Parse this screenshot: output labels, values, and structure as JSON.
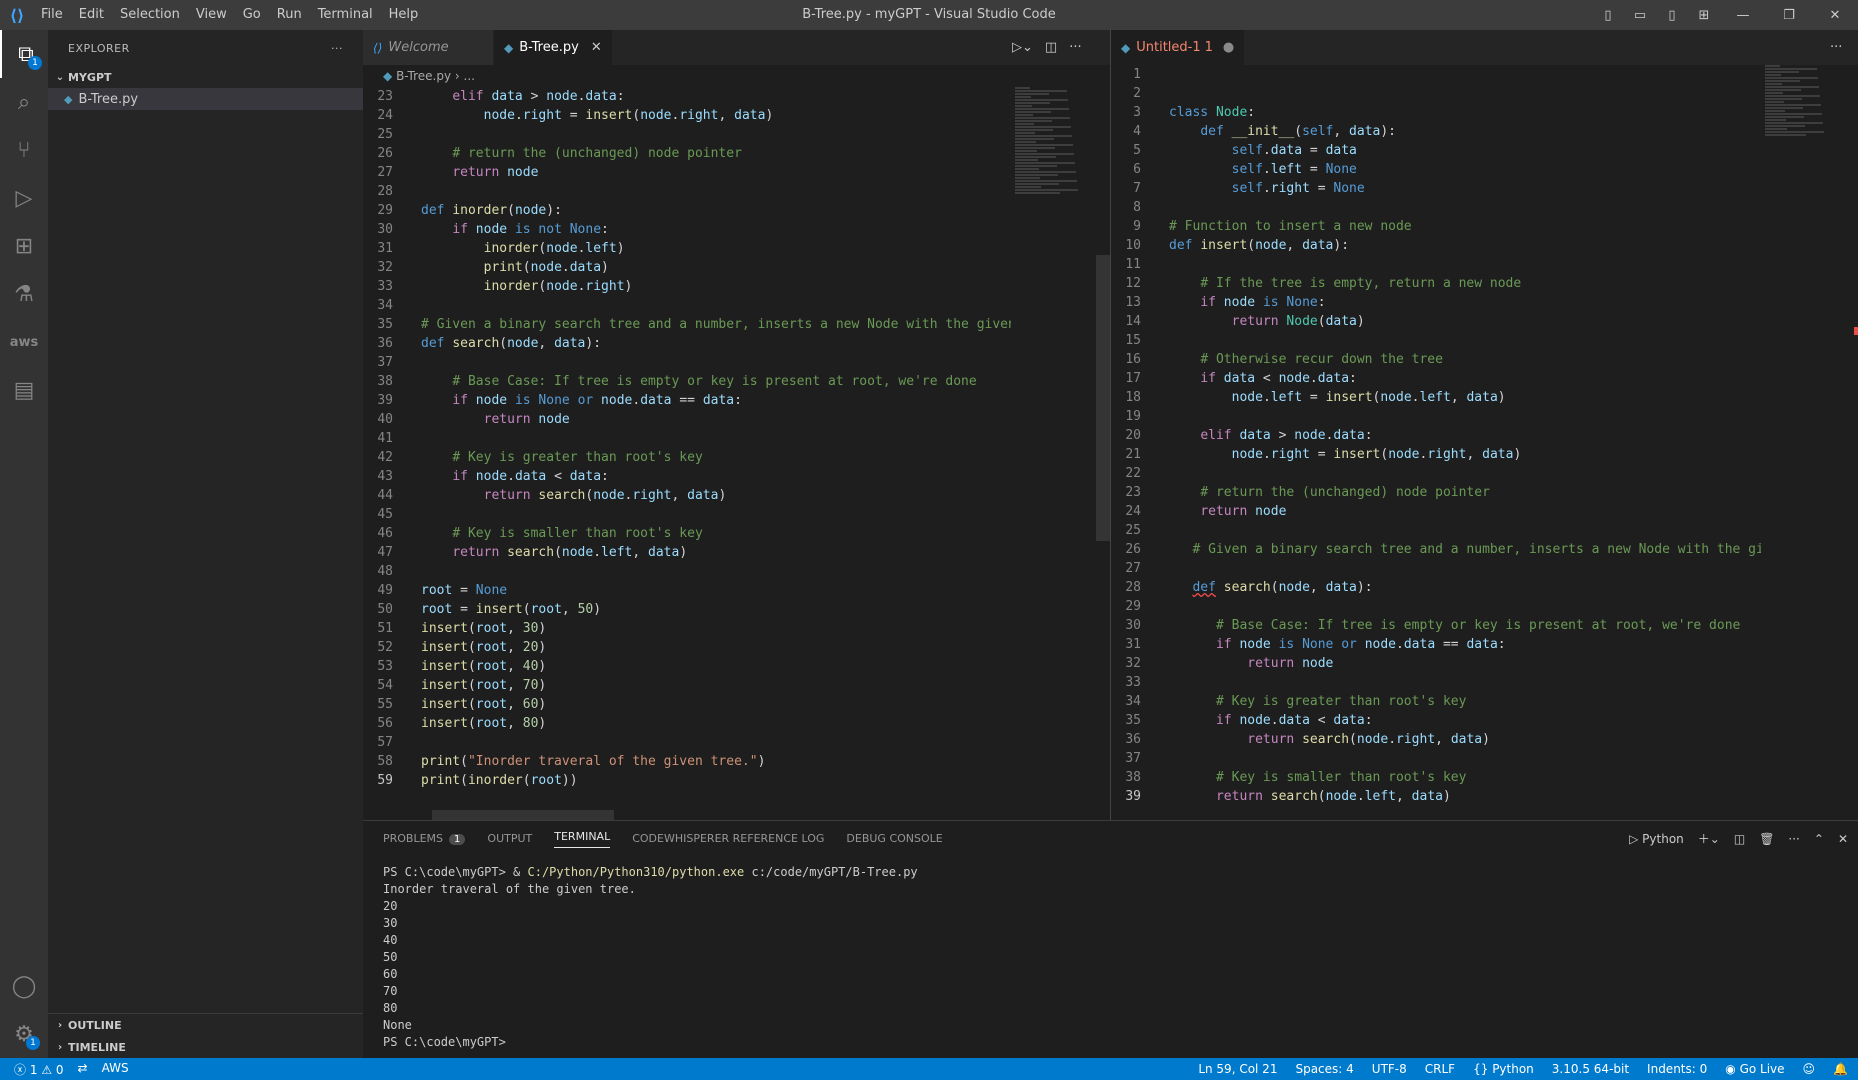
{
  "titlebar": {
    "logo": "vscode-logo",
    "menu": [
      "File",
      "Edit",
      "Selection",
      "View",
      "Go",
      "Run",
      "Terminal",
      "Help"
    ],
    "title": "B-Tree.py - myGPT - Visual Studio Code"
  },
  "activity": {
    "explorer_badge": "1",
    "settings_badge": "1",
    "aws_label": "aws"
  },
  "sidebar": {
    "title": "EXPLORER",
    "more": "···",
    "folder": "MYGPT",
    "files": [
      "B-Tree.py"
    ],
    "outline": "OUTLINE",
    "timeline": "TIMELINE"
  },
  "editor_left": {
    "tabs": [
      {
        "label": "Welcome",
        "icon": "vscode-icon"
      },
      {
        "label": "B-Tree.py",
        "icon": "python-icon",
        "close": "✕"
      }
    ],
    "breadcrumb": [
      "B-Tree.py",
      "..."
    ],
    "lines": [
      {
        "n": "23",
        "t": "    elif data > node.data:"
      },
      {
        "n": "24",
        "t": "        node.right = insert(node.right, data)"
      },
      {
        "n": "25",
        "t": ""
      },
      {
        "n": "26",
        "t": "    # return the (unchanged) node pointer"
      },
      {
        "n": "27",
        "t": "    return node"
      },
      {
        "n": "28",
        "t": ""
      },
      {
        "n": "29",
        "t": "def inorder(node):"
      },
      {
        "n": "30",
        "t": "    if node is not None:"
      },
      {
        "n": "31",
        "t": "        inorder(node.left)"
      },
      {
        "n": "32",
        "t": "        print(node.data)"
      },
      {
        "n": "33",
        "t": "        inorder(node.right)"
      },
      {
        "n": "34",
        "t": ""
      },
      {
        "n": "35",
        "t": "# Given a binary search tree and a number, inserts a new Node with the given"
      },
      {
        "n": "36",
        "t": "def search(node, data):"
      },
      {
        "n": "37",
        "t": ""
      },
      {
        "n": "38",
        "t": "    # Base Case: If tree is empty or key is present at root, we're done"
      },
      {
        "n": "39",
        "t": "    if node is None or node.data == data:"
      },
      {
        "n": "40",
        "t": "        return node"
      },
      {
        "n": "41",
        "t": ""
      },
      {
        "n": "42",
        "t": "    # Key is greater than root's key"
      },
      {
        "n": "43",
        "t": "    if node.data < data:"
      },
      {
        "n": "44",
        "t": "        return search(node.right, data)"
      },
      {
        "n": "45",
        "t": ""
      },
      {
        "n": "46",
        "t": "    # Key is smaller than root's key"
      },
      {
        "n": "47",
        "t": "    return search(node.left, data)"
      },
      {
        "n": "48",
        "t": ""
      },
      {
        "n": "49",
        "t": "root = None"
      },
      {
        "n": "50",
        "t": "root = insert(root, 50)"
      },
      {
        "n": "51",
        "t": "insert(root, 30)"
      },
      {
        "n": "52",
        "t": "insert(root, 20)"
      },
      {
        "n": "53",
        "t": "insert(root, 40)"
      },
      {
        "n": "54",
        "t": "insert(root, 70)"
      },
      {
        "n": "55",
        "t": "insert(root, 60)"
      },
      {
        "n": "56",
        "t": "insert(root, 80)"
      },
      {
        "n": "57",
        "t": ""
      },
      {
        "n": "58",
        "t": "print(\"Inorder traveral of the given tree.\")"
      },
      {
        "n": "59",
        "t": "print(inorder(root))"
      }
    ]
  },
  "editor_right": {
    "tabs": [
      {
        "label": "Untitled-1",
        "icon": "python-icon",
        "problems": "1",
        "dirty": "●"
      }
    ],
    "lines": [
      {
        "n": "1",
        "t": ""
      },
      {
        "n": "2",
        "t": ""
      },
      {
        "n": "3",
        "t": "class Node:"
      },
      {
        "n": "4",
        "t": "    def __init__(self, data):"
      },
      {
        "n": "5",
        "t": "        self.data = data"
      },
      {
        "n": "6",
        "t": "        self.left = None"
      },
      {
        "n": "7",
        "t": "        self.right = None"
      },
      {
        "n": "8",
        "t": ""
      },
      {
        "n": "9",
        "t": "# Function to insert a new node"
      },
      {
        "n": "10",
        "t": "def insert(node, data):"
      },
      {
        "n": "11",
        "t": ""
      },
      {
        "n": "12",
        "t": "    # If the tree is empty, return a new node"
      },
      {
        "n": "13",
        "t": "    if node is None:"
      },
      {
        "n": "14",
        "t": "        return Node(data)"
      },
      {
        "n": "15",
        "t": ""
      },
      {
        "n": "16",
        "t": "    # Otherwise recur down the tree"
      },
      {
        "n": "17",
        "t": "    if data < node.data:"
      },
      {
        "n": "18",
        "t": "        node.left = insert(node.left, data)"
      },
      {
        "n": "19",
        "t": ""
      },
      {
        "n": "20",
        "t": "    elif data > node.data:"
      },
      {
        "n": "21",
        "t": "        node.right = insert(node.right, data)"
      },
      {
        "n": "22",
        "t": ""
      },
      {
        "n": "23",
        "t": "    # return the (unchanged) node pointer"
      },
      {
        "n": "24",
        "t": "    return node"
      },
      {
        "n": "25",
        "t": ""
      },
      {
        "n": "26",
        "t": "   # Given a binary search tree and a number, inserts a new Node with the gi"
      },
      {
        "n": "27",
        "t": ""
      },
      {
        "n": "28",
        "t": "   def search(node, data):"
      },
      {
        "n": "29",
        "t": ""
      },
      {
        "n": "30",
        "t": "      # Base Case: If tree is empty or key is present at root, we're done"
      },
      {
        "n": "31",
        "t": "      if node is None or node.data == data:"
      },
      {
        "n": "32",
        "t": "          return node"
      },
      {
        "n": "33",
        "t": ""
      },
      {
        "n": "34",
        "t": "      # Key is greater than root's key"
      },
      {
        "n": "35",
        "t": "      if node.data < data:"
      },
      {
        "n": "36",
        "t": "          return search(node.right, data)"
      },
      {
        "n": "37",
        "t": ""
      },
      {
        "n": "38",
        "t": "      # Key is smaller than root's key"
      },
      {
        "n": "39",
        "t": "      return search(node.left, data)"
      }
    ]
  },
  "panel": {
    "tabs": [
      "PROBLEMS",
      "OUTPUT",
      "TERMINAL",
      "CODEWHISPERER REFERENCE LOG",
      "DEBUG CONSOLE"
    ],
    "problems_count": "1",
    "active_tab": "TERMINAL",
    "terminal_profile": "Python",
    "terminal": [
      "PS C:\\code\\myGPT> & C:/Python/Python310/python.exe c:/code/myGPT/B-Tree.py",
      "Inorder traveral of the given tree.",
      "20",
      "30",
      "40",
      "50",
      "60",
      "70",
      "80",
      "None",
      "PS C:\\code\\myGPT>"
    ]
  },
  "status": {
    "errors": "1",
    "warnings": "0",
    "aws": "AWS",
    "position": "Ln 59, Col 21",
    "spaces": "Spaces: 4",
    "encoding": "UTF-8",
    "eol": "CRLF",
    "language": "Python",
    "interpreter": "3.10.5 64-bit",
    "indents": "Indents: 0",
    "golive": "Go Live"
  },
  "colors": {
    "accent": "#007acc",
    "tab_dirty": "#f48771",
    "keyword": "#c586c0",
    "function": "#dcdcaa",
    "comment": "#6a9955"
  }
}
